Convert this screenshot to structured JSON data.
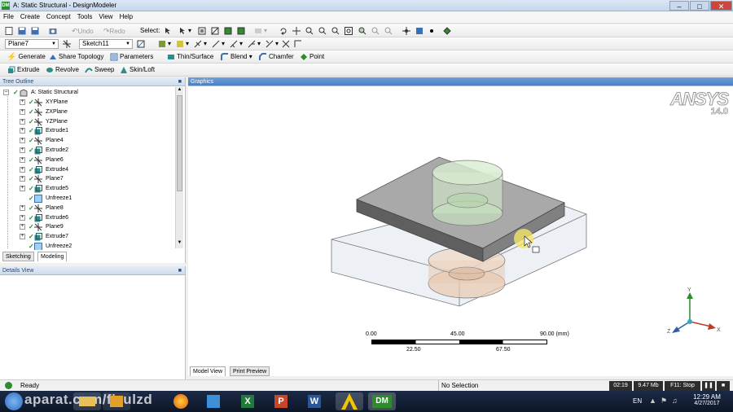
{
  "window": {
    "title": "A: Static Structural - DesignModeler",
    "app_icon": "DM"
  },
  "menu": [
    "File",
    "Create",
    "Concept",
    "Tools",
    "View",
    "Help"
  ],
  "toolbar1": {
    "undo": "Undo",
    "redo": "Redo",
    "select_label": "Select:"
  },
  "toolbar2": {
    "plane": "Plane7",
    "sketch": "Sketch11"
  },
  "toolbar3": {
    "generate": "Generate",
    "share_topology": "Share Topology",
    "parameters": "Parameters",
    "thin_surface": "Thin/Surface",
    "blend": "Blend",
    "chamfer": "Chamfer",
    "point": "Point"
  },
  "toolbar4": {
    "extrude": "Extrude",
    "revolve": "Revolve",
    "sweep": "Sweep",
    "skin_loft": "Skin/Loft"
  },
  "tree": {
    "header": "Tree Outline",
    "root": "A: Static Structural",
    "items": [
      {
        "label": "XYPlane",
        "type": "plane"
      },
      {
        "label": "ZXPlane",
        "type": "plane"
      },
      {
        "label": "YZPlane",
        "type": "plane"
      },
      {
        "label": "Extrude1",
        "type": "extrude"
      },
      {
        "label": "Plane4",
        "type": "plane"
      },
      {
        "label": "Extrude2",
        "type": "extrude"
      },
      {
        "label": "Plane6",
        "type": "plane"
      },
      {
        "label": "Extrude4",
        "type": "extrude"
      },
      {
        "label": "Plane7",
        "type": "plane"
      },
      {
        "label": "Extrude5",
        "type": "extrude"
      },
      {
        "label": "Unfreeze1",
        "type": "unfreeze"
      },
      {
        "label": "Plane8",
        "type": "plane"
      },
      {
        "label": "Extrude6",
        "type": "extrude"
      },
      {
        "label": "Plane9",
        "type": "plane"
      },
      {
        "label": "Extrude7",
        "type": "extrude"
      },
      {
        "label": "Unfreeze2",
        "type": "unfreeze"
      }
    ],
    "tabs": [
      "Sketching",
      "Modeling"
    ]
  },
  "details": {
    "header": "Details View"
  },
  "graphics": {
    "header": "Graphics",
    "logo": "ANSYS",
    "version": "14.0",
    "scale": {
      "top": [
        "0.00",
        "45.00",
        "90.00 (mm)"
      ],
      "bottom": [
        "22.50",
        "67.50"
      ]
    },
    "axes": {
      "y": "Y",
      "x": "X",
      "z": "Z"
    },
    "tabs": [
      "Model View",
      "Print Preview"
    ]
  },
  "status": {
    "ready": "Ready",
    "selection": "No Selection",
    "time": "02:19",
    "memory": "9.47 Mb",
    "stop": "F11: Stop"
  },
  "taskbar": {
    "watermark": "aparat.com/fizulzd",
    "lang": "EN",
    "clock_time": "12:29 AM",
    "clock_date": "4/27/2017",
    "dm_label": "DM"
  }
}
